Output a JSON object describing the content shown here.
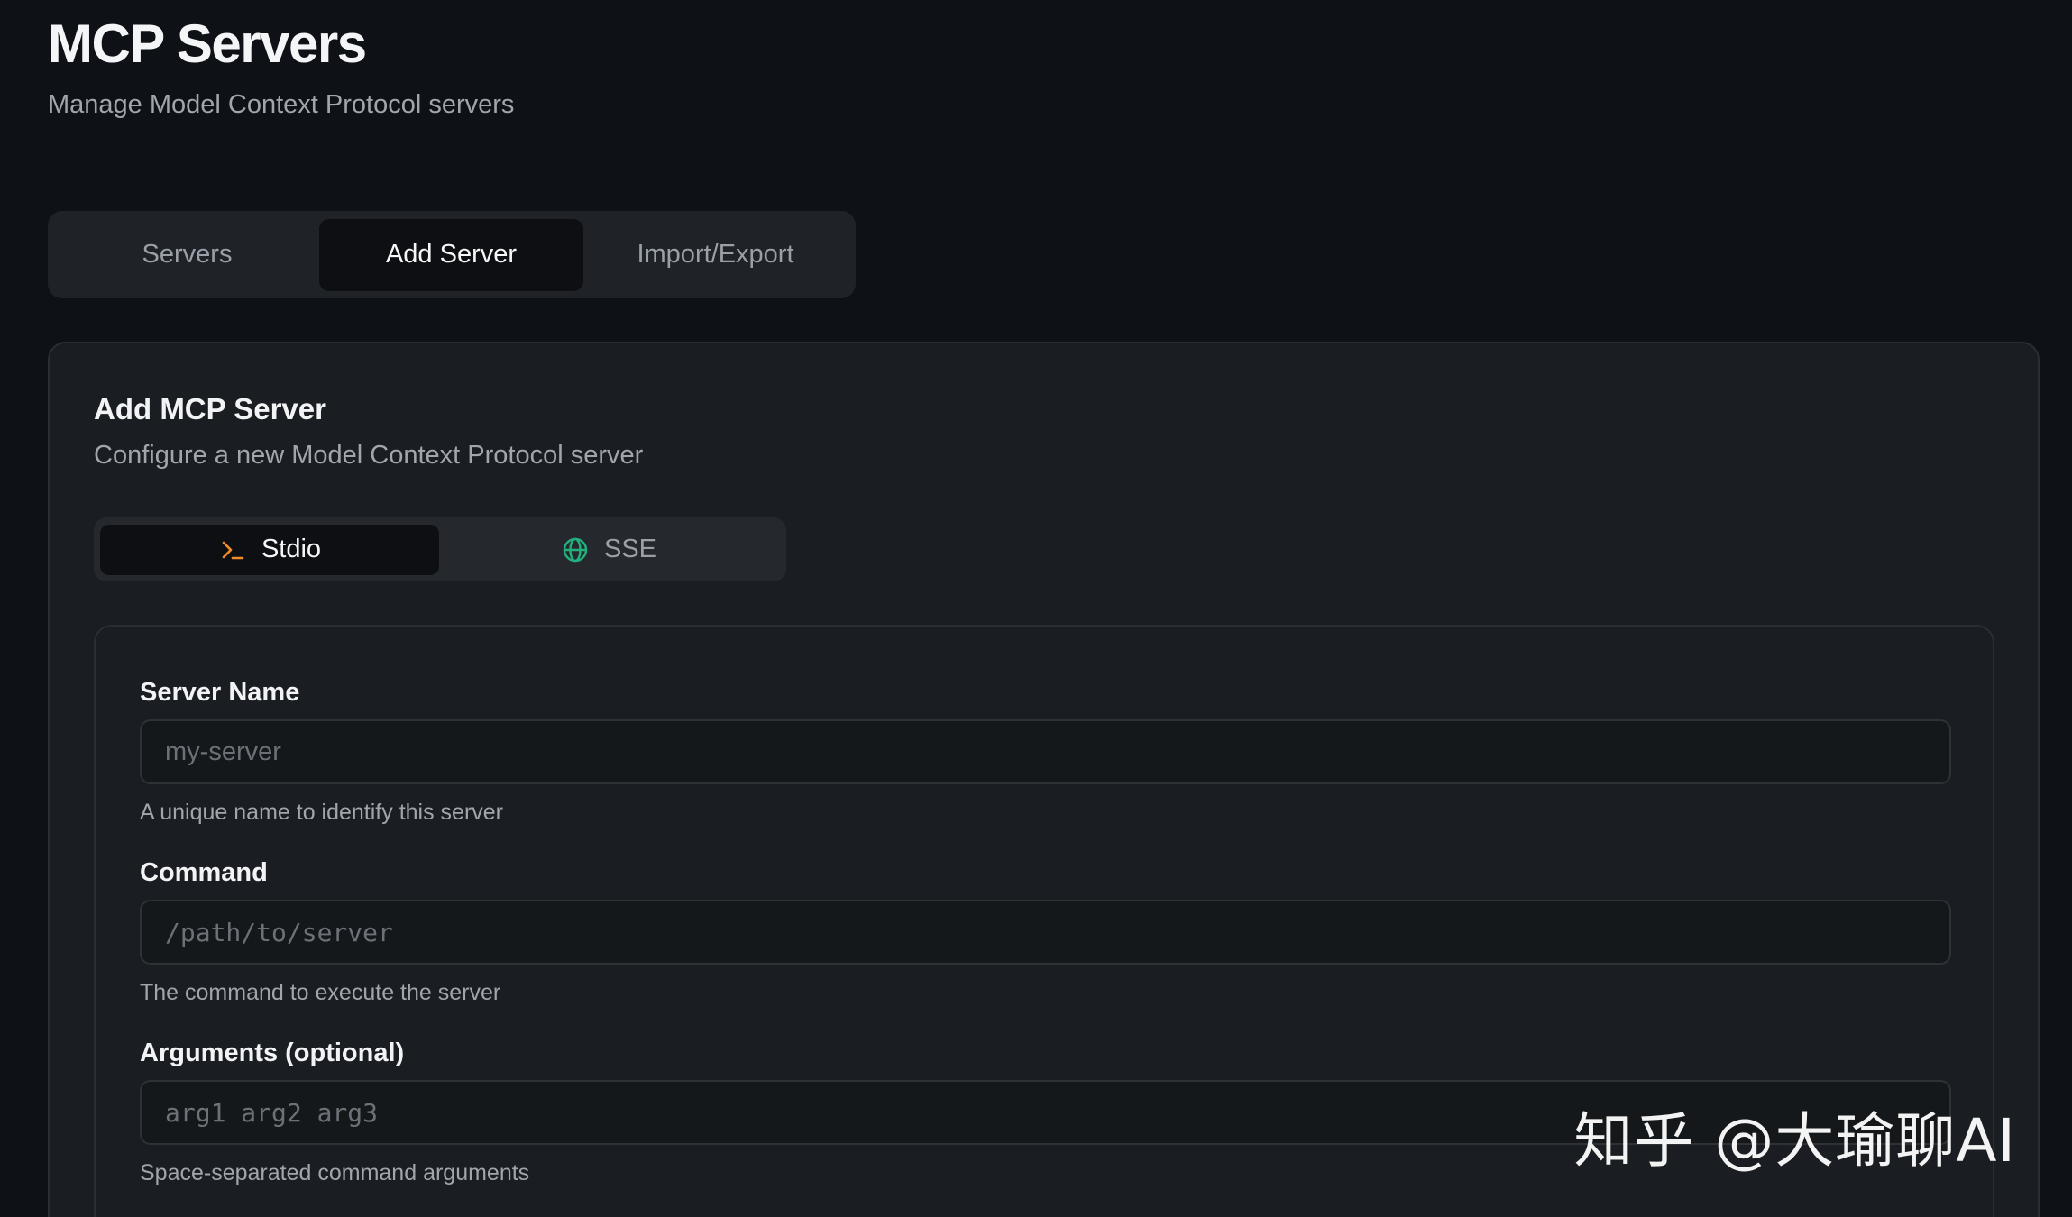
{
  "header": {
    "title": "MCP Servers",
    "subtitle": "Manage Model Context Protocol servers"
  },
  "tabs": [
    {
      "label": "Servers",
      "active": false
    },
    {
      "label": "Add Server",
      "active": true
    },
    {
      "label": "Import/Export",
      "active": false
    }
  ],
  "card": {
    "title": "Add MCP Server",
    "subtitle": "Configure a new Model Context Protocol server"
  },
  "transport": {
    "options": [
      {
        "label": "Stdio",
        "icon": "terminal-icon",
        "active": true
      },
      {
        "label": "SSE",
        "icon": "globe-icon",
        "active": false
      }
    ]
  },
  "form": {
    "server_name": {
      "label": "Server Name",
      "placeholder": "my-server",
      "value": "",
      "help": "A unique name to identify this server"
    },
    "command": {
      "label": "Command",
      "placeholder": "/path/to/server",
      "value": "",
      "help": "The command to execute the server"
    },
    "arguments": {
      "label": "Arguments (optional)",
      "placeholder": "arg1 arg2 arg3",
      "value": "",
      "help": "Space-separated command arguments"
    }
  },
  "watermark": "知乎 @大瑜聊AI",
  "colors": {
    "background": "#0e1115",
    "card": "#1a1d21",
    "terminal_icon": "#f28c28",
    "globe_icon": "#22b07d"
  }
}
